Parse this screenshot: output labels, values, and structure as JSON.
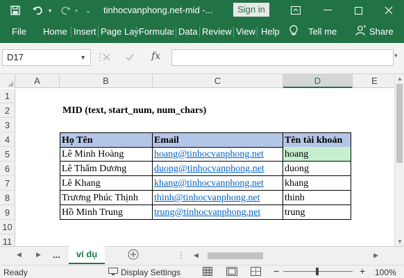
{
  "titlebar": {
    "file_title": "tinhocvanphong.net-mid  -...",
    "signin_label": "Sign in"
  },
  "ribbon": {
    "tabs": [
      "File",
      "Home",
      "Insert",
      "Page Lay",
      "Formulas",
      "Data",
      "Review",
      "View",
      "Help"
    ],
    "tell_me": "Tell me",
    "share": "Share"
  },
  "formula_bar": {
    "name_box": "D17",
    "fx_label": "fx",
    "formula": ""
  },
  "grid": {
    "columns": [
      "A",
      "B",
      "C",
      "D",
      "E"
    ],
    "rows": [
      "1",
      "2",
      "3",
      "4",
      "5",
      "6",
      "7",
      "8",
      "9",
      "10",
      "11"
    ],
    "title_text": "MID (text, start_num, num_chars)",
    "table_headers": [
      "Họ Tên",
      "Email",
      "Tên tài khoản"
    ],
    "table_rows": [
      [
        "Lê Minh Hoàng",
        "hoang@tinhocvanphong.net",
        "hoang"
      ],
      [
        "Lê Thẩm Dương",
        "duong@tinhocvanphong.net",
        "duong"
      ],
      [
        "Lê Khang",
        "khang@tinhocvanphong.net",
        "khang"
      ],
      [
        "Trương Phúc Thịnh",
        "thinh@tinhocvanphong.net",
        "thinh"
      ],
      [
        "Hồ Minh Trung",
        "trung@tinhocvanphong.net",
        "trung"
      ]
    ]
  },
  "sheet_tabs": {
    "ellipsis": "...",
    "active": "ví dụ"
  },
  "statusbar": {
    "ready": "Ready",
    "display_settings": "Display Settings",
    "zoom_minus": "−",
    "zoom_plus": "+",
    "zoom": "100%"
  },
  "colors": {
    "excel_green": "#217346",
    "header_fill": "#b4c6e7",
    "highlight_fill": "#c6efce",
    "link": "#0563c1"
  }
}
